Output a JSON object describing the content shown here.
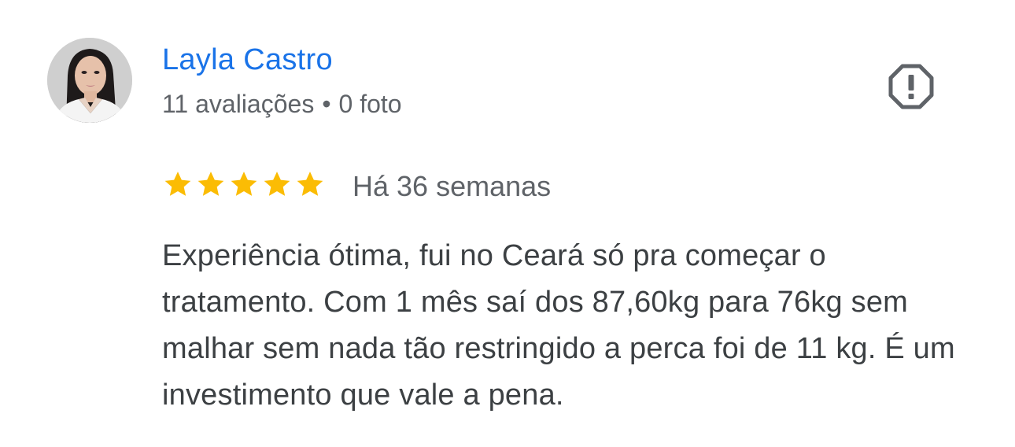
{
  "review": {
    "author": {
      "name": "Layla Castro",
      "reviews_count": "11 avaliações",
      "separator": "•",
      "photos_count": "0 foto",
      "avatar": "profile-photo"
    },
    "report_icon": "report-octagon-icon",
    "rating": 5,
    "rating_max": 5,
    "date": "Há 36 semanas",
    "text": "Experiência ótima, fui no Ceará só pra começar o tratamento. Com 1 mês saí dos 87,60kg para 76kg sem malhar sem nada tão restringido a perca foi de 11 kg. É um investimento que vale a pena.",
    "colors": {
      "author_name": "#1a73e8",
      "star": "#fbbc04",
      "meta_text": "#5f6368",
      "body_text": "#3c4043",
      "icon": "#5f6368"
    }
  }
}
